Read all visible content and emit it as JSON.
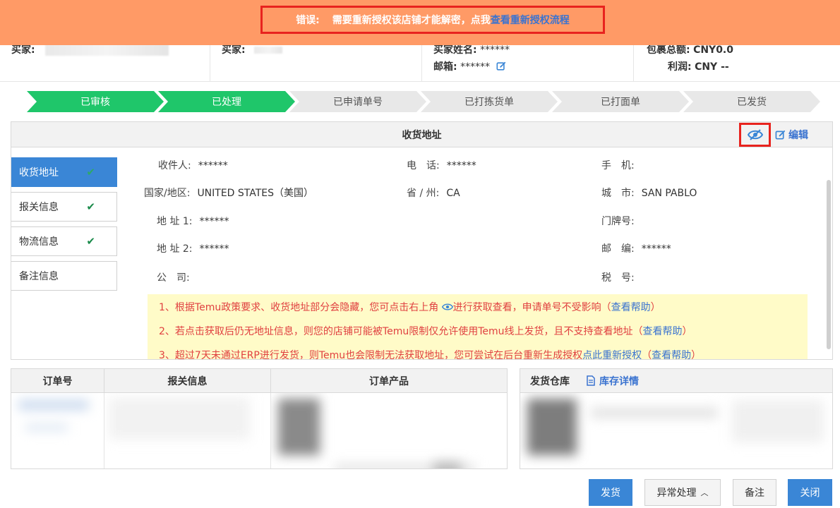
{
  "error_banner": {
    "label": "错误:",
    "message": "需要重新授权该店铺才能解密，点我",
    "link": "查看重新授权流程"
  },
  "info_strip": {
    "buyer_label": "买家:",
    "buyer2_label": "买家:",
    "buyer_name_label": "买家姓名:",
    "buyer_name_value": "******",
    "email_label": "邮箱:",
    "email_value": "******",
    "package_total_label": "包裹总额:",
    "package_total_value": "CNY0.0",
    "profit_label": "利润:",
    "profit_value": "CNY --"
  },
  "steps": [
    {
      "label": "已审核",
      "done": true
    },
    {
      "label": "已处理",
      "done": true
    },
    {
      "label": "已申请单号",
      "done": false
    },
    {
      "label": "已打拣货单",
      "done": false
    },
    {
      "label": "已打面单",
      "done": false
    },
    {
      "label": "已发货",
      "done": false
    }
  ],
  "address_panel": {
    "title": "收货地址",
    "edit_label": "编辑",
    "tabs": [
      {
        "label": "收货地址",
        "checked": true,
        "active": true
      },
      {
        "label": "报关信息",
        "checked": true,
        "active": false
      },
      {
        "label": "物流信息",
        "checked": true,
        "active": false
      },
      {
        "label": "备注信息",
        "checked": false,
        "active": false
      }
    ],
    "fields": {
      "recipient": {
        "label": "收件人:",
        "value": "******"
      },
      "phone": {
        "label": "电　话:",
        "value": "******"
      },
      "mobile": {
        "label": "手　机:",
        "value": ""
      },
      "country": {
        "label": "国家/地区:",
        "value": "UNITED STATES（美国）"
      },
      "province": {
        "label": "省 / 州:",
        "value": "CA"
      },
      "city": {
        "label": "城　市:",
        "value": "SAN PABLO"
      },
      "address1": {
        "label": "地 址 1:",
        "value": "******"
      },
      "house_no": {
        "label": "门牌号:",
        "value": ""
      },
      "address2": {
        "label": "地 址 2:",
        "value": "******"
      },
      "zip": {
        "label": "邮　编:",
        "value": "******"
      },
      "company": {
        "label": "公　司:",
        "value": ""
      },
      "tax_no": {
        "label": "税　号:",
        "value": ""
      }
    },
    "notices": [
      {
        "text_before": "1、根据Temu政策要求、收货地址部分会隐藏，您可点击右上角 ",
        "text_after": "进行获取查看，申请单号不受影响（",
        "link": "查看帮助",
        "close": "）"
      },
      {
        "text_before": "2、若点击获取后仍无地址信息，则您的店铺可能被Temu限制仅允许使用Temu线上发货，且不支持查看地址（",
        "link": "查看帮助",
        "close": "）"
      },
      {
        "text_before": "3、超过7天未通过ERP进行发货，则Temu也会限制无法获取地址，您可尝试在后台重新生成授权",
        "link1": "点此重新授权",
        "mid": "（",
        "link": "查看帮助",
        "close": "）"
      }
    ]
  },
  "orders_table": {
    "headers": [
      "订单号",
      "报关信息",
      "订单产品"
    ]
  },
  "warehouse": {
    "title": "发货仓库",
    "stock_link": "库存详情"
  },
  "buttons": {
    "ship": "发货",
    "exception": "异常处理",
    "note": "备注",
    "close": "关闭"
  },
  "colors": {
    "banner": "#ff9a66",
    "step_done": "#1fc66a",
    "step_todo": "#e8e8e8",
    "primary": "#3a86d6",
    "highlight": "#e8231e"
  }
}
